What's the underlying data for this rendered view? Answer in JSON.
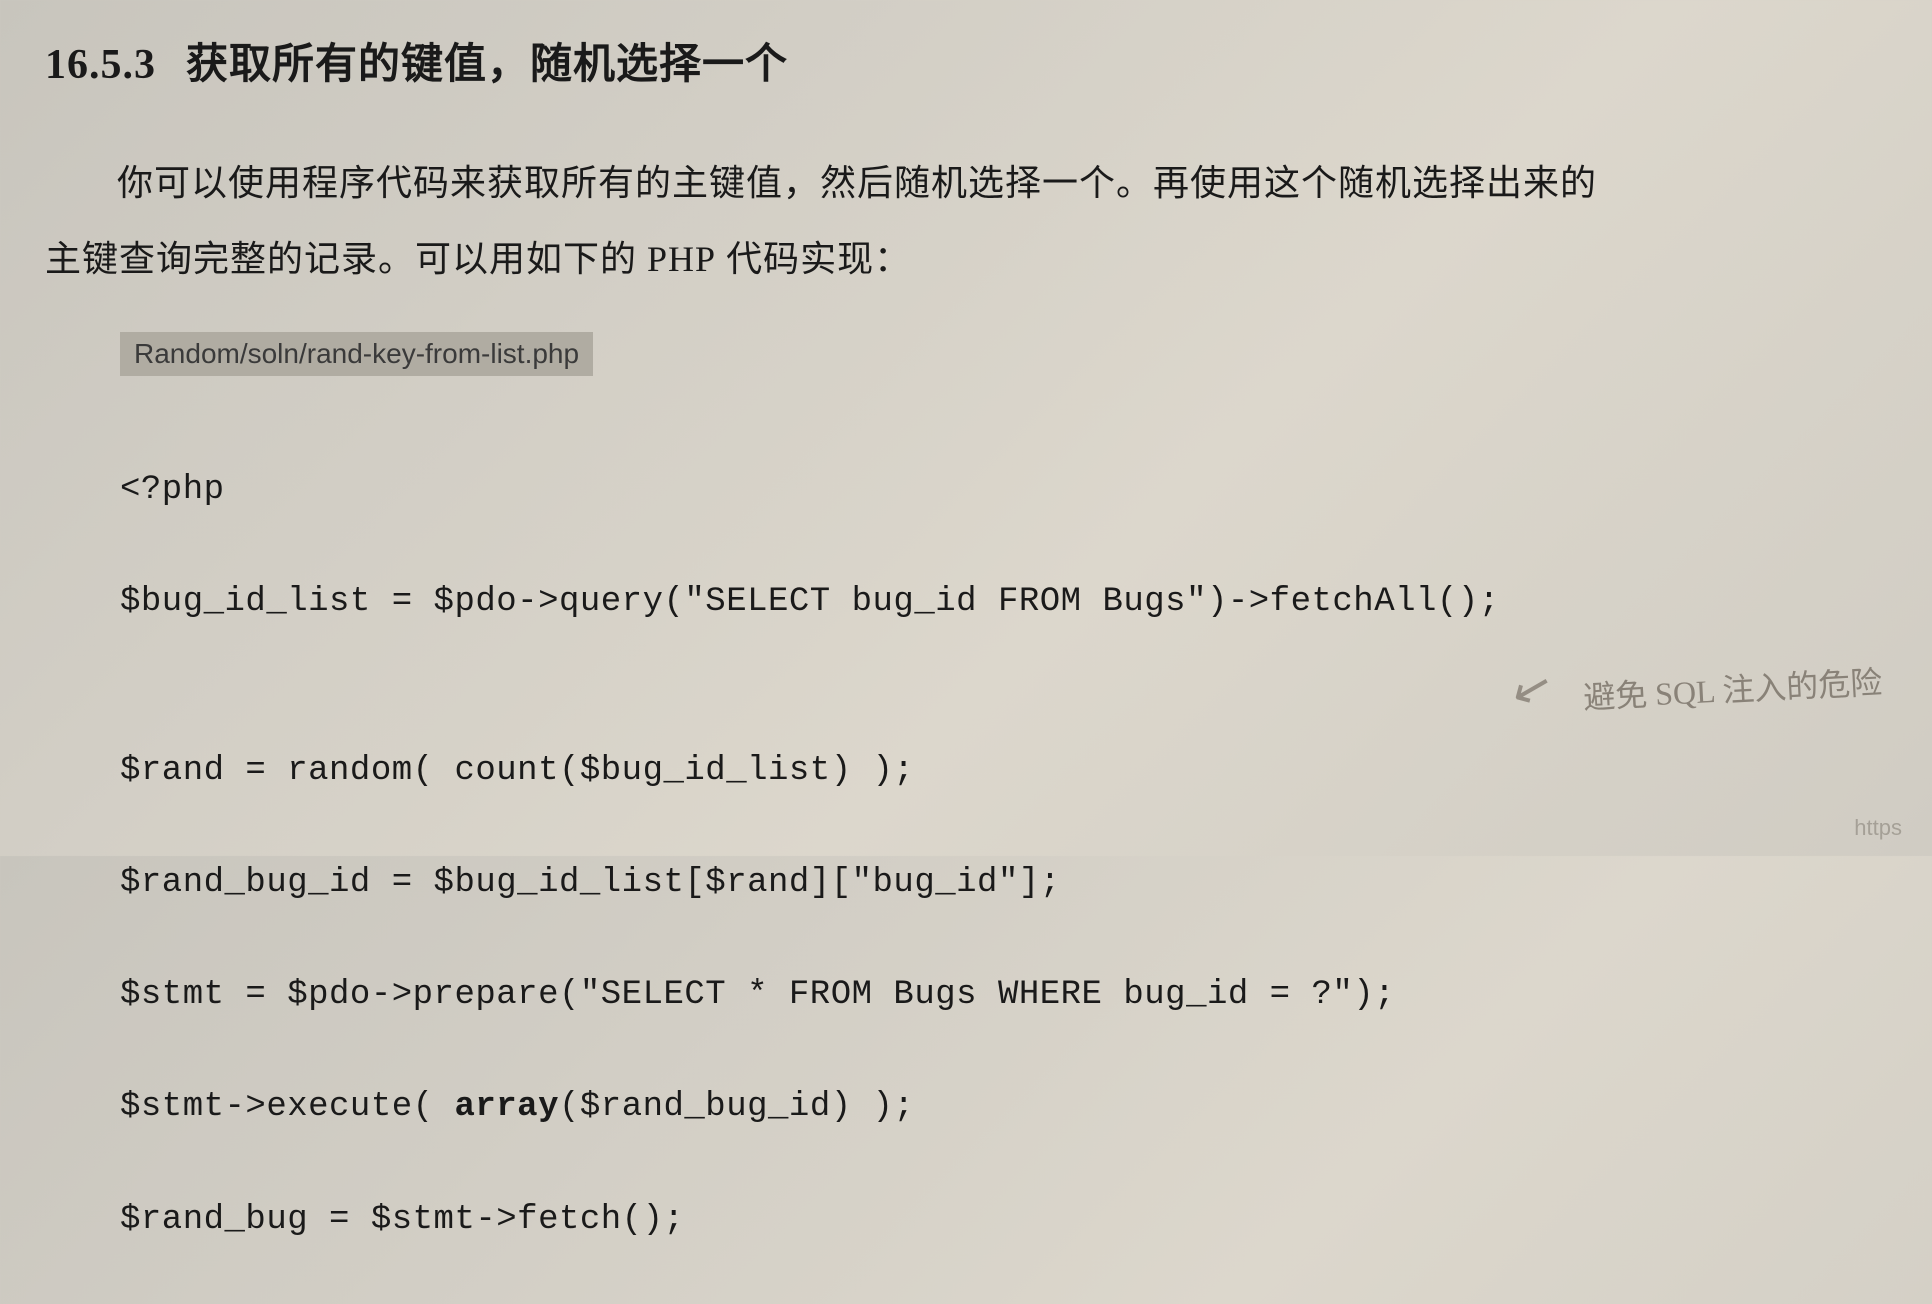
{
  "heading": {
    "section_number": "16.5.3",
    "title": "获取所有的键值，随机选择一个"
  },
  "paragraph": {
    "line1_indent": "你可以使用程序代码来获取所有的主键值，然后随机选择一个。再使用这个随机选择出来的",
    "line2": "主键查询完整的记录。可以用如下的 ",
    "php_word": "PHP",
    "line2_suffix": " 代码实现："
  },
  "code": {
    "file_path": "Random/soln/rand-key-from-list.php",
    "lines": {
      "l1": "<?php",
      "l2": "$bug_id_list = $pdo->query(\"SELECT bug_id FROM Bugs\")->fetchAll();",
      "l3": "",
      "l4": "$rand = random( count($bug_id_list) );",
      "l5": "$rand_bug_id = $bug_id_list[$rand][\"bug_id\"];",
      "l6_a": "$stmt = $pdo->prepare(\"SELECT * FROM Bugs WHERE bug_id = ?\");",
      "l7_a": "$stmt->execute( ",
      "l7_bold": "array",
      "l7_b": "($rand_bug_id) );",
      "l8": "$rand_bug = $stmt->fetch();"
    }
  },
  "annotations": {
    "handwriting": "避免 SQL 注入的危险",
    "arrow": "↙"
  },
  "watermark": "https"
}
